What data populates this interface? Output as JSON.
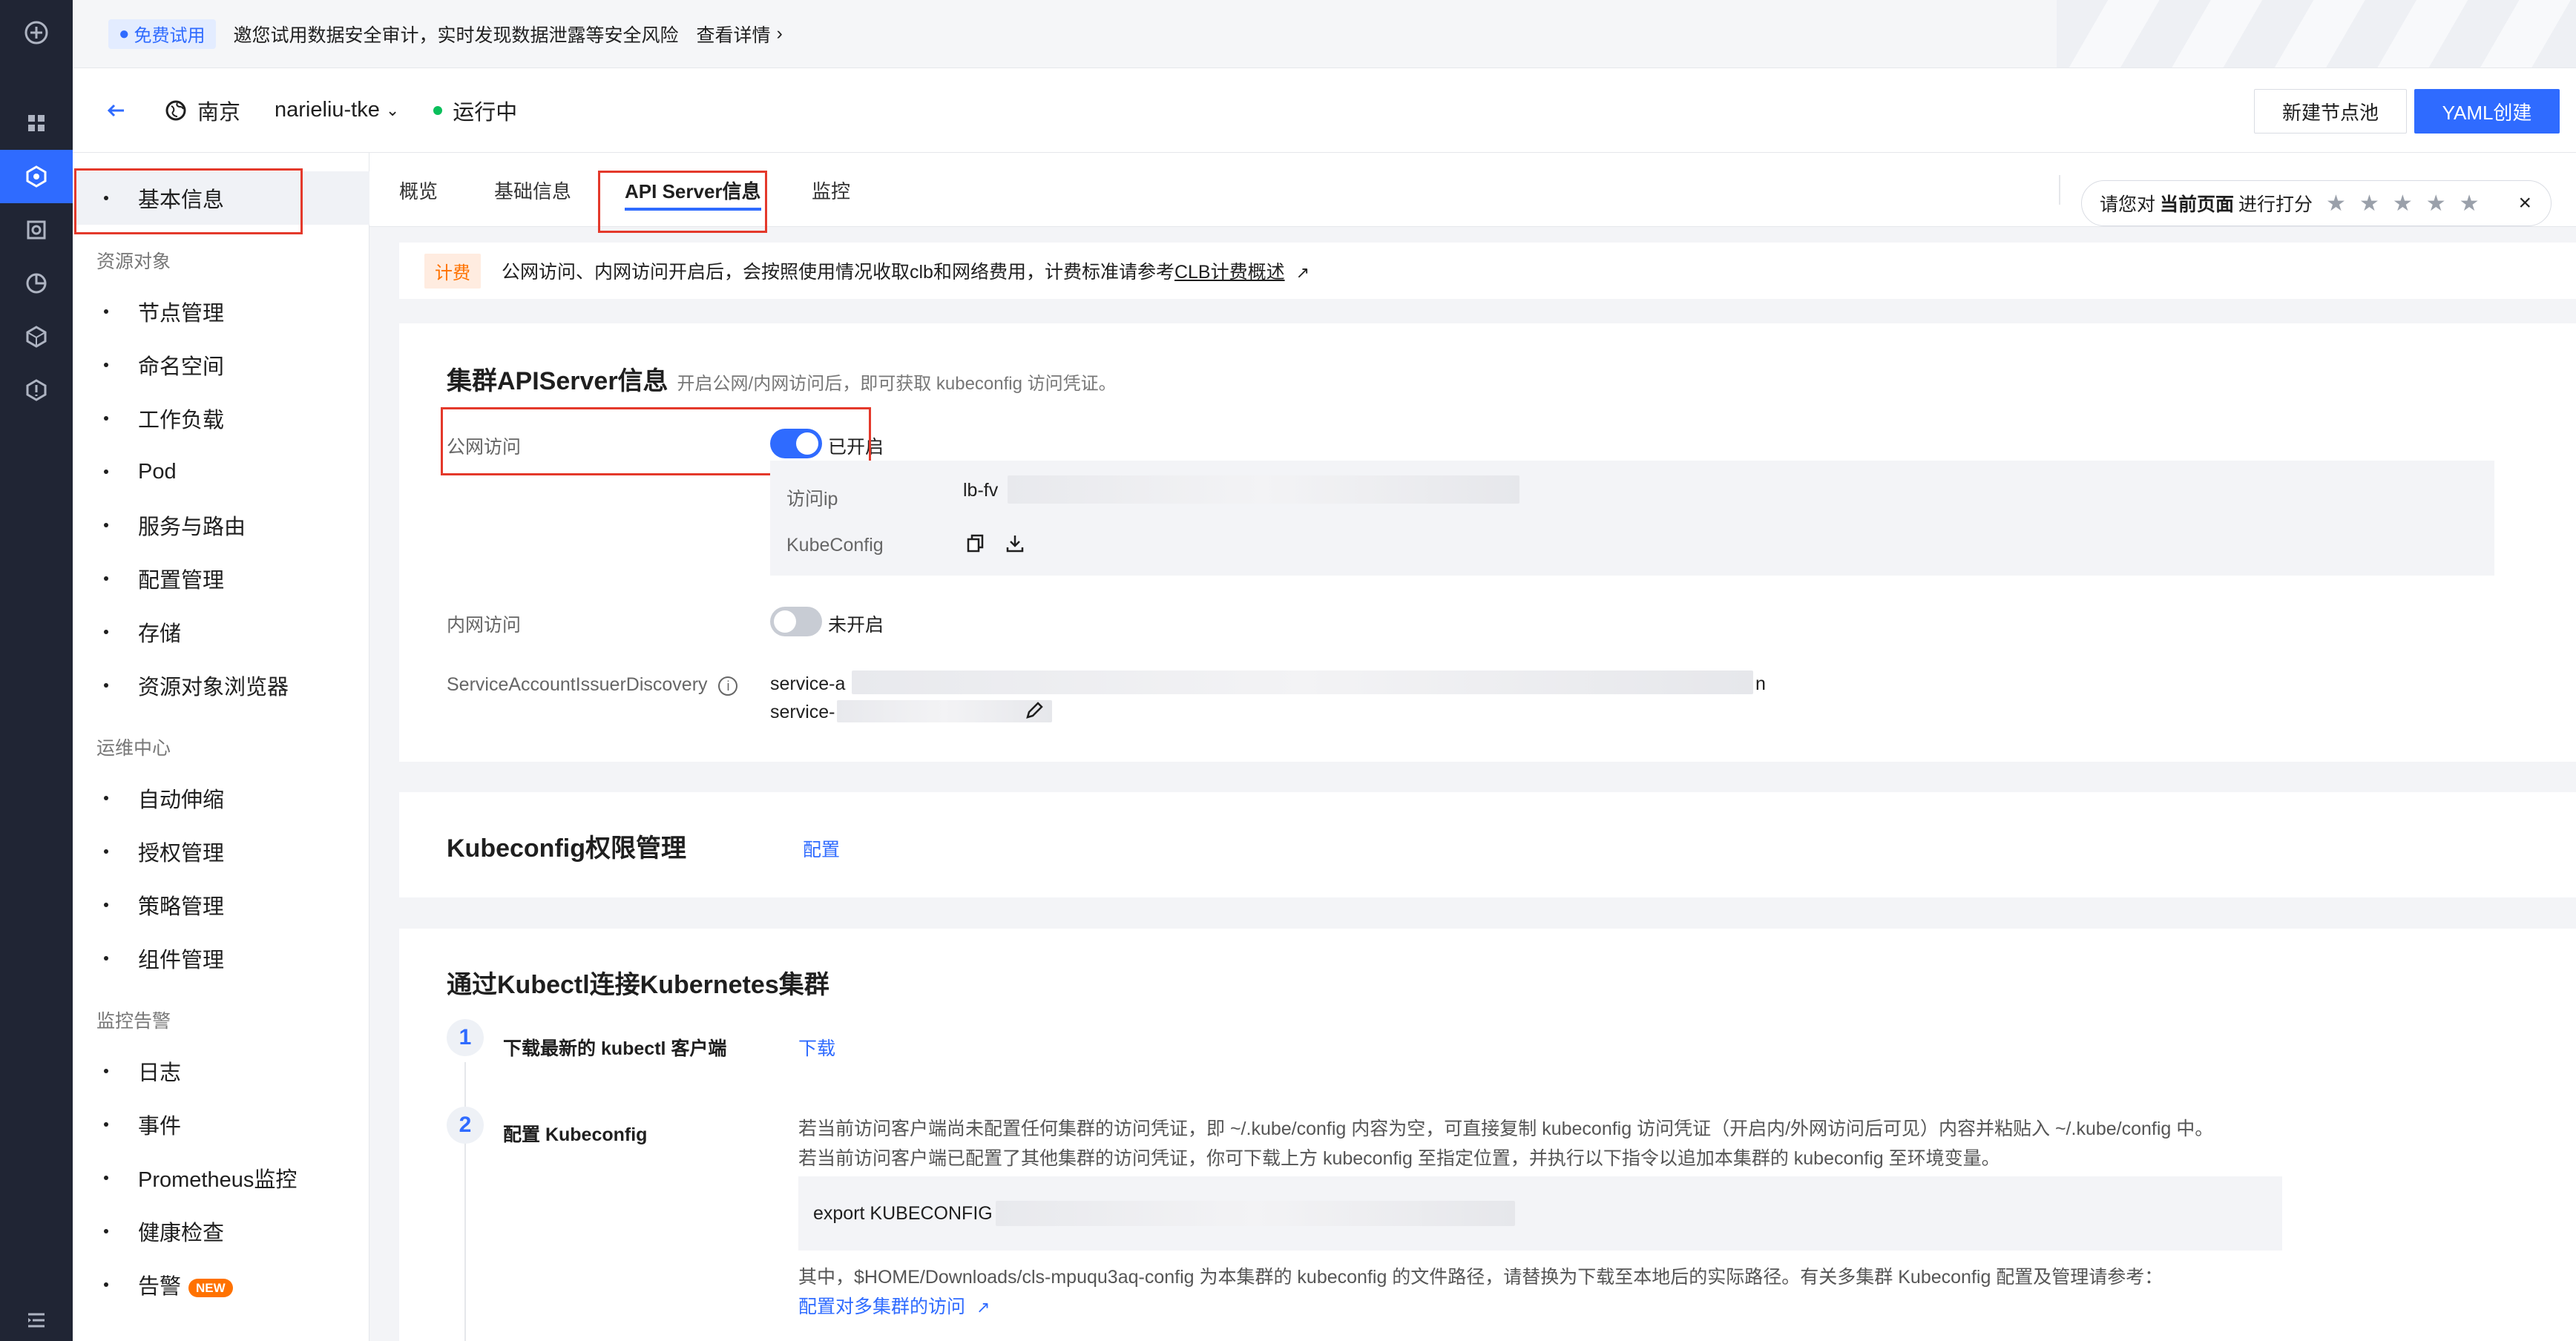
{
  "banner": {
    "tag": "免费试用",
    "message": "邀您试用数据安全审计，实时发现数据泄露等安全风险",
    "link": "查看详情"
  },
  "header": {
    "region": "南京",
    "cluster": "narieliu-tke",
    "status": "运行中",
    "btn_nodepool": "新建节点池",
    "btn_yaml": "YAML创建"
  },
  "sidebar": {
    "basic": "基本信息",
    "group_resources": "资源对象",
    "resources": [
      "节点管理",
      "命名空间",
      "工作负载",
      "Pod",
      "服务与路由",
      "配置管理",
      "存储",
      "资源对象浏览器"
    ],
    "group_ops": "运维中心",
    "ops": [
      "自动伸缩",
      "授权管理",
      "策略管理",
      "组件管理"
    ],
    "group_monitor": "监控告警",
    "monitor": [
      "日志",
      "事件",
      "Prometheus监控",
      "健康检查",
      "告警"
    ],
    "new_badge": "NEW"
  },
  "tabs": [
    "概览",
    "基础信息",
    "API Server信息",
    "监控"
  ],
  "rating": {
    "prefix": "请您对",
    "bold": "当前页面",
    "suffix": "进行打分",
    "stars": "★★★★★",
    "close": "×"
  },
  "notice": {
    "tag": "计费",
    "text": "公网访问、内网访问开启后，会按照使用情况收取clb和网络费用，计费标准请参考",
    "link": "CLB计费概述"
  },
  "apiserver": {
    "title": "集群APIServer信息",
    "subtitle": "开启公网/内网访问后，即可获取 kubeconfig 访问凭证。",
    "public_label": "公网访问",
    "public_state": "已开启",
    "ip_label": "访问ip",
    "ip_value": "lb-fv",
    "kubeconfig_label": "KubeConfig",
    "private_label": "内网访问",
    "private_state": "未开启",
    "sa_label": "ServiceAccountIssuerDiscovery",
    "sa_line1": "service-a",
    "sa_line1_tail": "n",
    "sa_line2": "service-"
  },
  "kubeconfig_perm": {
    "title": "Kubeconfig权限管理",
    "action": "配置"
  },
  "kubectl": {
    "title": "通过Kubectl连接Kubernetes集群",
    "step1_num": "1",
    "step1": "下载最新的 kubectl 客户端",
    "step1_action": "下载",
    "step2_num": "2",
    "step2": "配置 Kubeconfig",
    "desc1": "若当前访问客户端尚未配置任何集群的访问凭证，即 ~/.kube/config 内容为空，可直接复制 kubeconfig 访问凭证（开启内/外网访问后可见）内容并粘贴入 ~/.kube/config 中。",
    "desc2": "若当前访问客户端已配置了其他集群的访问凭证，你可下载上方 kubeconfig 至指定位置，并执行以下指令以追加本集群的 kubeconfig 至环境变量。",
    "code": "export KUBECONFIG",
    "note": "其中，$HOME/Downloads/cls-mpuqu3aq-config 为本集群的 kubeconfig 的文件路径，请替换为下载至本地后的实际路径。有关多集群 Kubeconfig 配置及管理请参考：",
    "note_link": "配置对多集群的访问"
  },
  "colors": {
    "primary": "#2f6bff",
    "running": "#0abf5b",
    "highlight": "#e4392b",
    "fee": "#ff7200"
  }
}
